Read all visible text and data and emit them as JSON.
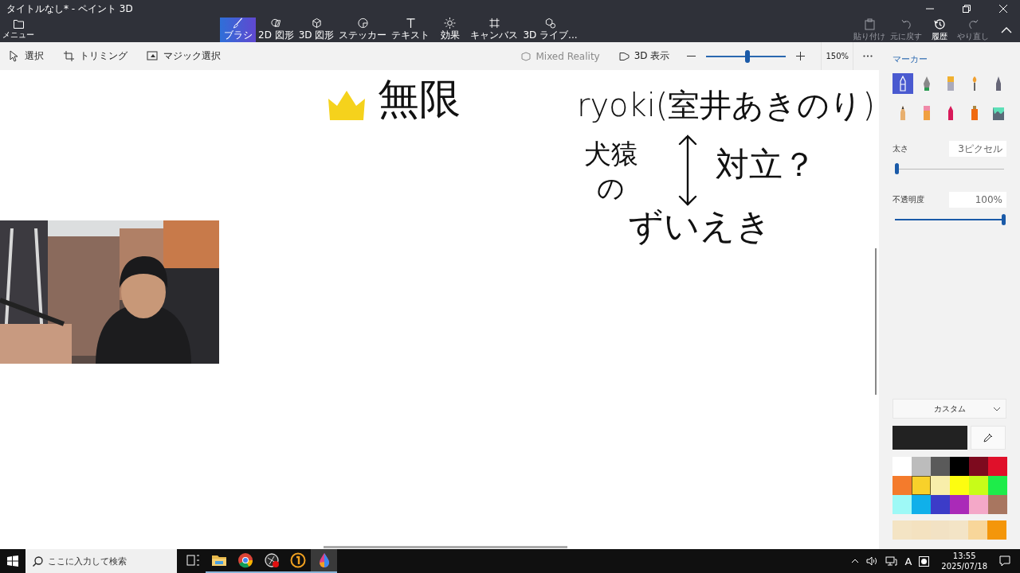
{
  "window": {
    "title": "タイトルなし* - ペイント 3D"
  },
  "toolbar": {
    "menu": {
      "label": "メニュー"
    },
    "tools": [
      {
        "kind": "brush",
        "label": "ブラシ",
        "selected": true
      },
      {
        "kind": "shape2d",
        "label": "2D 図形",
        "selected": false
      },
      {
        "kind": "shape3d",
        "label": "3D 図形",
        "selected": false
      },
      {
        "kind": "sticker",
        "label": "ステッカー",
        "selected": false
      },
      {
        "kind": "text",
        "label": "テキスト",
        "selected": false
      },
      {
        "kind": "effects",
        "label": "効果",
        "selected": false
      },
      {
        "kind": "canvas",
        "label": "キャンバス",
        "selected": false
      },
      {
        "kind": "library",
        "label": "3D ライブ...",
        "selected": false
      }
    ],
    "actions": [
      {
        "kind": "paste",
        "label": "貼り付け",
        "disabled": true
      },
      {
        "kind": "undo",
        "label": "元に戻す",
        "disabled": true
      },
      {
        "kind": "history",
        "label": "履歴",
        "disabled": false
      },
      {
        "kind": "redo",
        "label": "やり直し",
        "disabled": true
      }
    ]
  },
  "subbar": {
    "tools": [
      {
        "kind": "select",
        "label": "選択"
      },
      {
        "kind": "crop",
        "label": "トリミング"
      },
      {
        "kind": "magic",
        "label": "マジック選択"
      }
    ],
    "mixed_reality": {
      "label": "Mixed Reality",
      "disabled": true
    },
    "view_3d": {
      "label": "3D 表示"
    },
    "zoom": {
      "level": 0.52,
      "reading": "150%"
    }
  },
  "canvas": {
    "drawings": [
      {
        "kind": "crown"
      },
      {
        "kind": "text",
        "text": "無限"
      },
      {
        "kind": "text",
        "text": "ryoki(室井あきのり)"
      },
      {
        "kind": "text",
        "text": "犬猿の"
      },
      {
        "kind": "double-arrow"
      },
      {
        "kind": "text",
        "text": "対立？"
      },
      {
        "kind": "text",
        "text": "ずいえき"
      }
    ]
  },
  "panel": {
    "title": "マーカー",
    "brushes": [
      {
        "kind": "marker",
        "selected": true
      },
      {
        "kind": "pen",
        "selected": false
      },
      {
        "kind": "oil",
        "selected": false
      },
      {
        "kind": "watercolor",
        "selected": false
      },
      {
        "kind": "pixel",
        "selected": false
      },
      {
        "kind": "pencil",
        "selected": false
      },
      {
        "kind": "eraser",
        "selected": false
      },
      {
        "kind": "crayon",
        "selected": false
      },
      {
        "kind": "spray",
        "selected": false
      },
      {
        "kind": "fill",
        "selected": false
      }
    ],
    "thickness": {
      "label": "太さ",
      "value": "3ピクセル",
      "level": 0.02
    },
    "opacity": {
      "label": "不透明度",
      "value": "100%",
      "level": 1
    },
    "color_mode": {
      "value": "カスタム"
    },
    "current_color": {
      "color": "#222222"
    },
    "palette": [
      {
        "color": "#ffffff",
        "selected": false
      },
      {
        "color": "#bcbcbc",
        "selected": false
      },
      {
        "color": "#5a5a5a",
        "selected": false
      },
      {
        "color": "#000000",
        "selected": false
      },
      {
        "color": "#7d0a1e",
        "selected": false
      },
      {
        "color": "#e0102a",
        "selected": false
      },
      {
        "color": "#f47b2c",
        "selected": false
      },
      {
        "color": "#f8d12a",
        "selected": true
      },
      {
        "color": "#f8eeaa",
        "selected": false
      },
      {
        "color": "#fdfd10",
        "selected": false
      },
      {
        "color": "#c8fc18",
        "selected": false
      },
      {
        "color": "#1eec4a",
        "selected": false
      },
      {
        "color": "#9ef9f6",
        "selected": false
      },
      {
        "color": "#10b0ea",
        "selected": false
      },
      {
        "color": "#3c3cc8",
        "selected": false
      },
      {
        "color": "#aa2ab8",
        "selected": false
      },
      {
        "color": "#f4a8c8",
        "selected": false
      },
      {
        "color": "#a87660",
        "selected": false
      }
    ],
    "recent_colors": [
      {
        "color": "#f4e4c4"
      },
      {
        "color": "#f4e2c0"
      },
      {
        "color": "#f2e2c4"
      },
      {
        "color": "#f3e4c6"
      },
      {
        "color": "#f8d69a"
      },
      {
        "color": "#f4960a"
      }
    ]
  },
  "taskbar": {
    "search": {
      "placeholder": "ここに入力して検索"
    },
    "apps": [
      {
        "kind": "taskview",
        "running": false,
        "active": false
      },
      {
        "kind": "folder",
        "running": true,
        "active": false
      },
      {
        "kind": "chrome",
        "running": true,
        "active": false
      },
      {
        "kind": "recorder",
        "running": true,
        "active": false
      },
      {
        "kind": "coin",
        "running": true,
        "active": false
      },
      {
        "kind": "paint3d",
        "running": true,
        "active": true
      }
    ],
    "tray": {
      "ime": "A",
      "time": "13:55",
      "date": "2025/07/18"
    }
  }
}
